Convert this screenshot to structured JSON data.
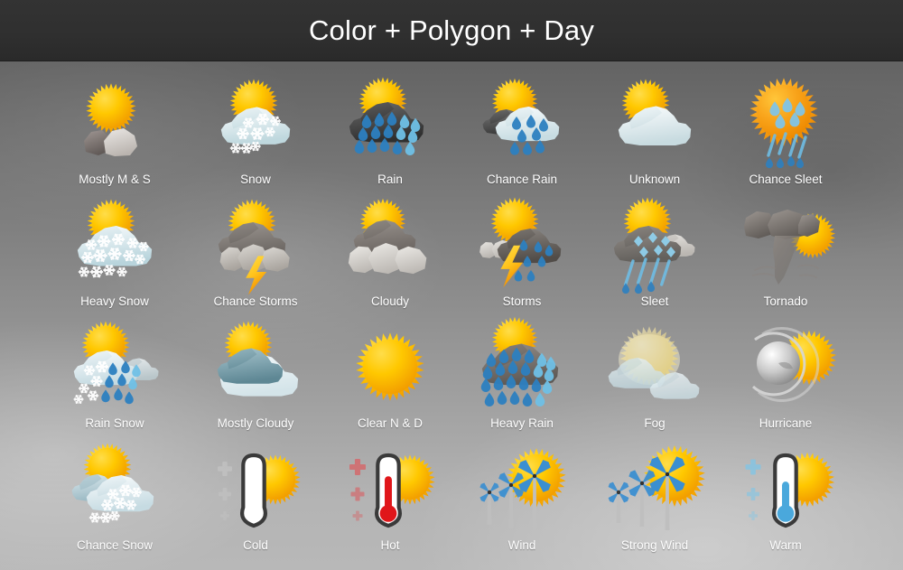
{
  "header": {
    "title": "Color + Polygon + Day",
    "background_color": "#2f2f2f",
    "text_color": "#ffffff"
  },
  "palette": {
    "sun_light": "#FFDD4A",
    "sun_mid": "#FFC800",
    "sun_dark": "#F29D00",
    "cloud_white": "#F2F6F8",
    "cloud_light_gray": "#D8D8D8",
    "cloud_gray": "#8E8A87",
    "cloud_dark": "#4B4B4B",
    "cloud_teal": "#7FA7B4",
    "rain_blue": "#2C7FC0",
    "rain_blue_light": "#6FC0E6",
    "snow_white": "#FFFFFF",
    "lightning_yellow": "#FFC21A",
    "thermo_outline": "#3A3A3A",
    "hot_red": "#E0161A",
    "warm_blue": "#4AA8DC",
    "turbine_blue": "#3B8FD1",
    "label_color": "#ffffff",
    "background_top": "#595959",
    "background_bottom": "#b8b8b8"
  },
  "grid": {
    "columns": 6,
    "rows": 4,
    "icon_count": 24
  },
  "icons": [
    {
      "id": "mostly-m-and-s",
      "label": "Mostly M & S",
      "row": 1,
      "col": 1,
      "art": "sun-rocks"
    },
    {
      "id": "snow",
      "label": "Snow",
      "row": 1,
      "col": 2,
      "art": "sun-cloud-snow"
    },
    {
      "id": "rain",
      "label": "Rain",
      "row": 1,
      "col": 3,
      "art": "sun-darkcloud-rain"
    },
    {
      "id": "chance-rain",
      "label": "Chance Rain",
      "row": 1,
      "col": 4,
      "art": "sun-whitecloud-rain"
    },
    {
      "id": "unknown",
      "label": "Unknown",
      "row": 1,
      "col": 5,
      "art": "sun-cloud-plain"
    },
    {
      "id": "chance-sleet",
      "label": "Chance Sleet",
      "row": 1,
      "col": 6,
      "art": "sun-sleet"
    },
    {
      "id": "heavy-snow",
      "label": "Heavy Snow",
      "row": 2,
      "col": 1,
      "art": "sun-cloud-heavysnow"
    },
    {
      "id": "chance-storms",
      "label": "Chance Storms",
      "row": 2,
      "col": 2,
      "art": "sun-graycloud-bolt"
    },
    {
      "id": "cloudy",
      "label": "Cloudy",
      "row": 2,
      "col": 3,
      "art": "sun-cloudy"
    },
    {
      "id": "storms",
      "label": "Storms",
      "row": 2,
      "col": 4,
      "art": "sun-cloud-bolt-rain"
    },
    {
      "id": "sleet",
      "label": "Sleet",
      "row": 2,
      "col": 5,
      "art": "sun-cloud-sleet"
    },
    {
      "id": "tornado",
      "label": "Tornado",
      "row": 2,
      "col": 6,
      "art": "tornado-sun"
    },
    {
      "id": "rain-snow",
      "label": "Rain Snow",
      "row": 3,
      "col": 1,
      "art": "sun-cloud-rainsnow"
    },
    {
      "id": "mostly-cloudy",
      "label": "Mostly Cloudy",
      "row": 3,
      "col": 2,
      "art": "sun-mostly-cloudy"
    },
    {
      "id": "clear-n-and-d",
      "label": "Clear N & D",
      "row": 3,
      "col": 3,
      "art": "sun-only"
    },
    {
      "id": "heavy-rain",
      "label": "Heavy Rain",
      "row": 3,
      "col": 4,
      "art": "sun-cloud-heavyrain"
    },
    {
      "id": "fog",
      "label": "Fog",
      "row": 3,
      "col": 5,
      "art": "fog-sun"
    },
    {
      "id": "hurricane",
      "label": "Hurricane",
      "row": 3,
      "col": 6,
      "art": "hurricane-sun"
    },
    {
      "id": "chance-snow",
      "label": "Chance Snow",
      "row": 4,
      "col": 1,
      "art": "sun-cloud-chancesnow"
    },
    {
      "id": "cold",
      "label": "Cold",
      "row": 4,
      "col": 2,
      "art": "thermometer-cold"
    },
    {
      "id": "hot",
      "label": "Hot",
      "row": 4,
      "col": 3,
      "art": "thermometer-hot"
    },
    {
      "id": "wind",
      "label": "Wind",
      "row": 4,
      "col": 4,
      "art": "wind-turbines"
    },
    {
      "id": "strong-wind",
      "label": "Strong Wind",
      "row": 4,
      "col": 5,
      "art": "strong-wind-turbines"
    },
    {
      "id": "warm",
      "label": "Warm",
      "row": 4,
      "col": 6,
      "art": "thermometer-warm"
    }
  ]
}
